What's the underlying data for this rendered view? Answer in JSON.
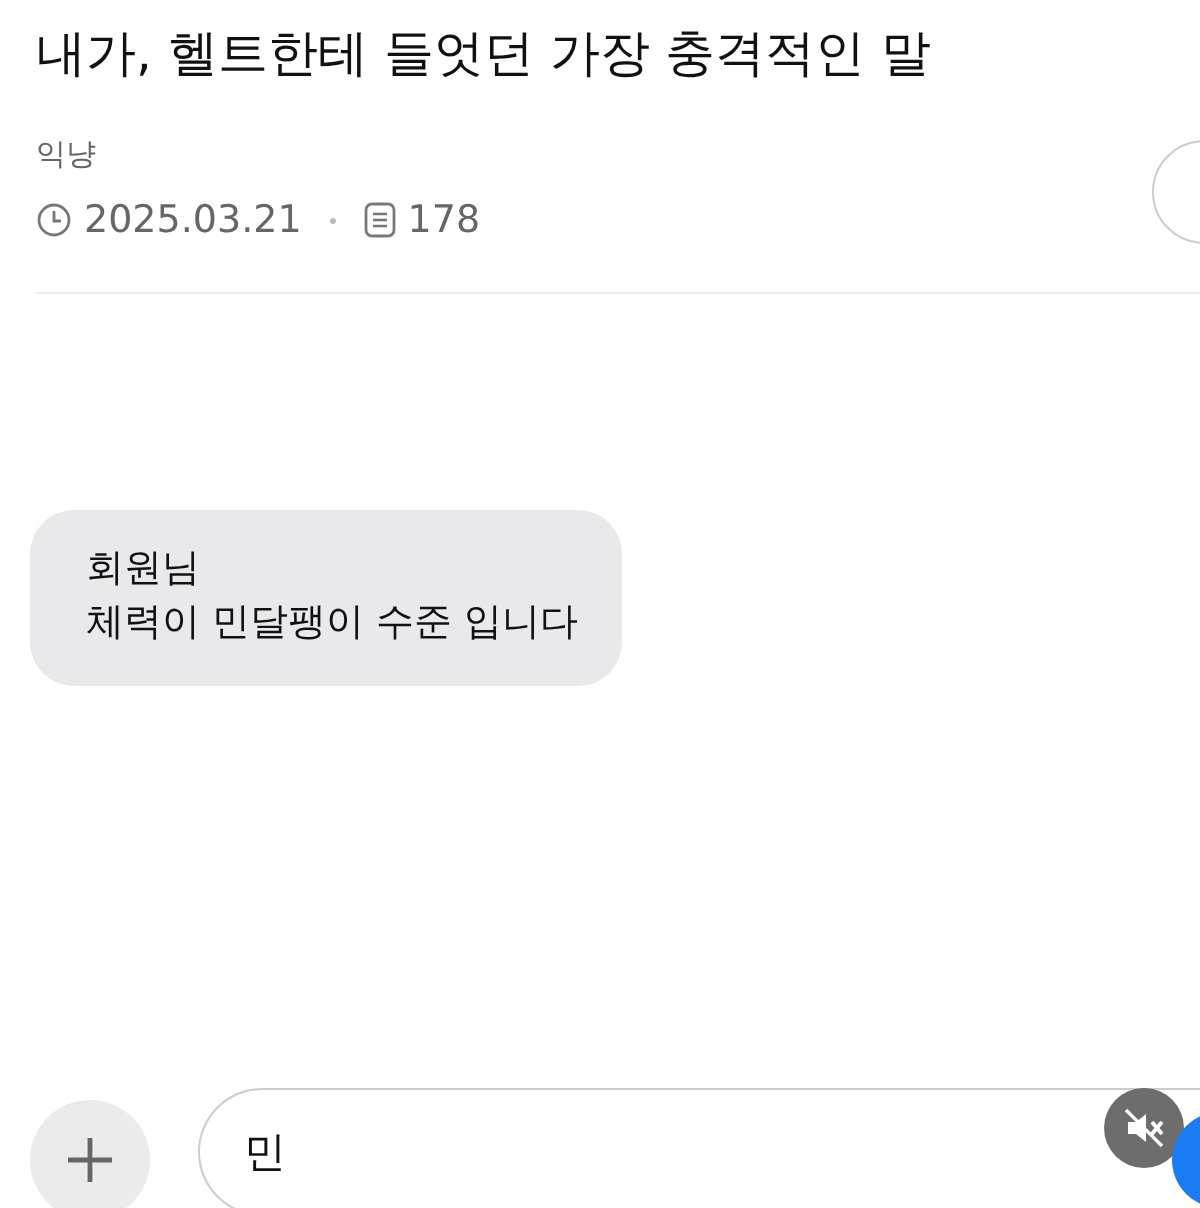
{
  "post": {
    "title": "내가, 헬트한테 들엇던 가장 충격적인 말",
    "author": "익냥",
    "date": "2025.03.21",
    "views": "178"
  },
  "chat": {
    "messages": [
      {
        "lines": [
          "회원님",
          "체력이 민달팽이 수준 입니다"
        ]
      }
    ]
  },
  "composer": {
    "value": "민",
    "muted": true
  }
}
